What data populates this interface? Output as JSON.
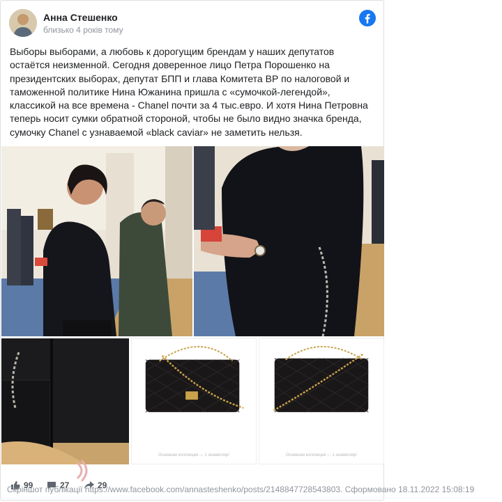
{
  "post": {
    "author": "Анна Стешенко",
    "time": "близько 4 років тому",
    "text": [
      "Выборы выборами, а любовь к дорогущим брендам у наших депутатов остаётся неизменной. Сегодня доверенное лицо Петра Порошенко на президентских выборах, депутат БПП и глава Комитета ВР по налоговой и таможенной политике Нина Южанина пришла с «сумочкой-легендой», классикой на все времена - Chanel почти за 4 тыс.евро. И хотя Нина Петровна теперь носит сумки обратной стороной, чтобы не было видно значка бренда, сумочку Chanel с узнаваемой «black caviar» не заметить нельзя."
    ],
    "photo_captions": [
      "Основная коллекция — 1 экземпляр!",
      "Основная коллекция — 1 экземпляр!"
    ]
  },
  "actions": {
    "likes": "99",
    "comments": "27",
    "shares": "29"
  },
  "footer": {
    "text": "Скріншот публікації https://www.facebook.com/annasteshenko/posts/2148847728543803. Сформовано 18.11.2022 15:08:19"
  },
  "colors": {
    "facebook_blue": "#1877f2",
    "text": "#1c1e21",
    "muted": "#90949c"
  }
}
